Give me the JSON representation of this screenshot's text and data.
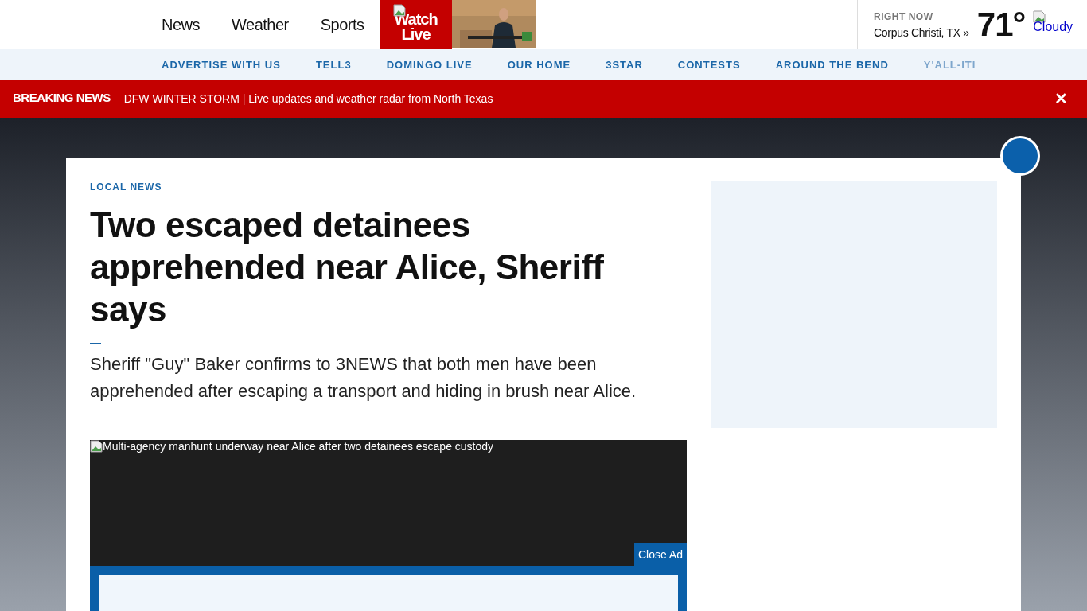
{
  "header": {
    "nav": [
      "News",
      "Weather",
      "Sports"
    ],
    "watch_live": "Watch\nLive",
    "weather": {
      "label": "RIGHT NOW",
      "location": "Corpus Christi, TX »",
      "temperature": "71°",
      "condition": "Cloudy"
    }
  },
  "subnav": [
    "ADVERTISE WITH US",
    "TELL3",
    "DOMINGO LIVE",
    "OUR HOME",
    "3STAR",
    "CONTESTS",
    "AROUND THE BEND",
    "Y'ALL-ITI"
  ],
  "breaking": {
    "label": "BREAKING NEWS",
    "text": "DFW WINTER STORM | Live updates and weather radar from North Texas",
    "close": "✕"
  },
  "article": {
    "category": "LOCAL NEWS",
    "headline": "Two escaped detainees apprehended near Alice, Sheriff says",
    "summary": "Sheriff \"Guy\" Baker confirms to 3NEWS that both men have been apprehended after escaping a transport and hiding in brush near Alice.",
    "image_alt": "Multi-agency manhunt underway near Alice after two detainees escape custody",
    "close_ad": "Close Ad"
  }
}
